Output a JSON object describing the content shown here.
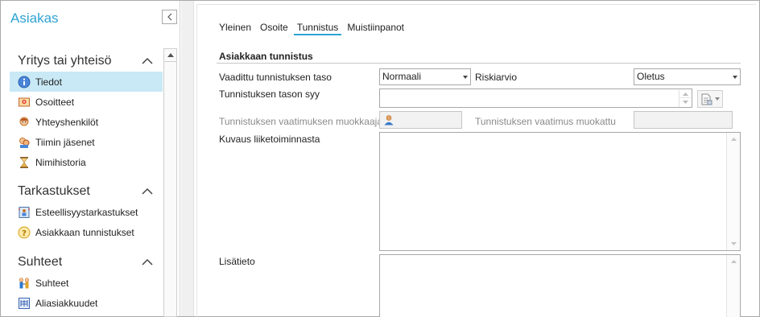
{
  "sidebar": {
    "title": "Asiakas",
    "sections": [
      {
        "heading": "Yritys tai yhteisö",
        "items": [
          {
            "label": "Tiedot",
            "icon": "info-icon"
          },
          {
            "label": "Osoitteet",
            "icon": "address-card-icon"
          },
          {
            "label": "Yhteyshenkilöt",
            "icon": "contact-person-icon"
          },
          {
            "label": "Tiimin jäsenet",
            "icon": "team-members-icon"
          },
          {
            "label": "Nimihistoria",
            "icon": "hourglass-icon"
          }
        ]
      },
      {
        "heading": "Tarkastukset",
        "items": [
          {
            "label": "Esteellisyystarkastukset",
            "icon": "conflict-check-icon"
          },
          {
            "label": "Asiakkaan tunnistukset",
            "icon": "question-badge-icon"
          }
        ]
      },
      {
        "heading": "Suhteet",
        "items": [
          {
            "label": "Suhteet",
            "icon": "relations-icon"
          },
          {
            "label": "Aliasiakkuudet",
            "icon": "sub-clients-icon"
          }
        ]
      }
    ]
  },
  "tabs": [
    "Yleinen",
    "Osoite",
    "Tunnistus",
    "Muistiinpanot"
  ],
  "active_tab": "Tunnistus",
  "form": {
    "section_title": "Asiakkaan tunnistus",
    "required_level_label": "Vaadittu tunnistuksen taso",
    "required_level_value": "Normaali",
    "risk_label": "Riskiarvio",
    "risk_value": "Oletus",
    "level_reason_label": "Tunnistuksen tason syy",
    "level_reason_value": "",
    "modifier_label": "Tunnistuksen vaatimuksen muokkaaja",
    "modified_label": "Tunnistuksen vaatimus muokattu",
    "modified_value": "",
    "description_label": "Kuvaus liiketoiminnasta",
    "description_value": "",
    "additional_label": "Lisätieto",
    "additional_value": ""
  },
  "colors": {
    "accent": "#2fa3d4",
    "active_item_bg": "#c8e9f5"
  }
}
